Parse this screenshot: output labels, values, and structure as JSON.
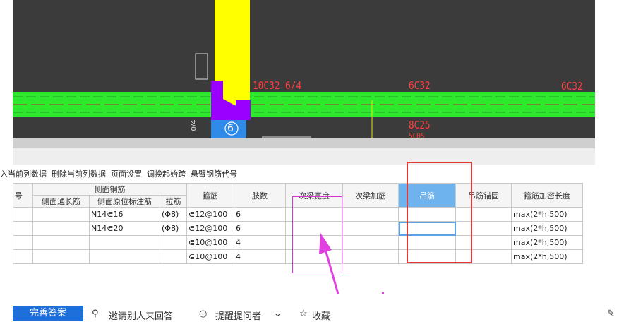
{
  "cad": {
    "labels": {
      "beam_left": "10C32 6/4",
      "beam_mid": "6C32",
      "beam_right": "6C32",
      "bottom_mid_1": "8C25",
      "bottom_mid_2": "5C05",
      "axis_number": "6",
      "vertical_tag": "0/4"
    }
  },
  "toolbar": {
    "items": [
      "入当前列数据",
      "删除当前列数据",
      "页面设置",
      "调换起始跨",
      "悬臂钢筋代号"
    ]
  },
  "table": {
    "header_group": "侧面钢筋",
    "col_num": "号",
    "sub_headers": [
      "侧面通长筋",
      "侧面原位标注筋",
      "拉筋"
    ],
    "headers": [
      "箍筋",
      "肢数",
      "次梁宽度",
      "次梁加筋",
      "吊筋",
      "吊筋锚固",
      "箍筋加密长度"
    ],
    "selected_header": "吊筋",
    "rows": [
      {
        "through": "",
        "orig": "N14⋐16",
        "tie": "(Φ8)",
        "stirrup": "⋐12@100",
        "legs": "6",
        "width": "",
        "add": "",
        "hanger": "",
        "anchor": "",
        "dense": "max(2*h,500)"
      },
      {
        "through": "",
        "orig": "N14⋐20",
        "tie": "(Φ8)",
        "stirrup": "⋐12@100",
        "legs": "6",
        "width": "",
        "add": "",
        "hanger": "",
        "anchor": "",
        "dense": "max(2*h,500)"
      },
      {
        "through": "",
        "orig": "",
        "tie": "",
        "stirrup": "⋐10@100",
        "legs": "4",
        "width": "",
        "add": "",
        "hanger": "",
        "anchor": "",
        "dense": "max(2*h,500)"
      },
      {
        "through": "",
        "orig": "",
        "tie": "",
        "stirrup": "⋐10@100",
        "legs": "4",
        "width": "",
        "add": "",
        "hanger": "",
        "anchor": "",
        "dense": "max(2*h,500)"
      }
    ]
  },
  "bottom": {
    "primary_button": "完善答案",
    "invite": "邀请别人来回答",
    "remind": "提醒提问者",
    "favorite": "收藏"
  },
  "colors": {
    "cad_bg": "#3b3b3b",
    "beam_green": "#2ee82e",
    "column_yellow": "#ffff00",
    "column_purple": "#9900ff",
    "text_red": "#ff3d3d",
    "annotation_red": "#e53935",
    "annotation_magenta": "#d633d6",
    "selected_header": "#6fb3ee",
    "primary_blue": "#1e6fd9"
  }
}
